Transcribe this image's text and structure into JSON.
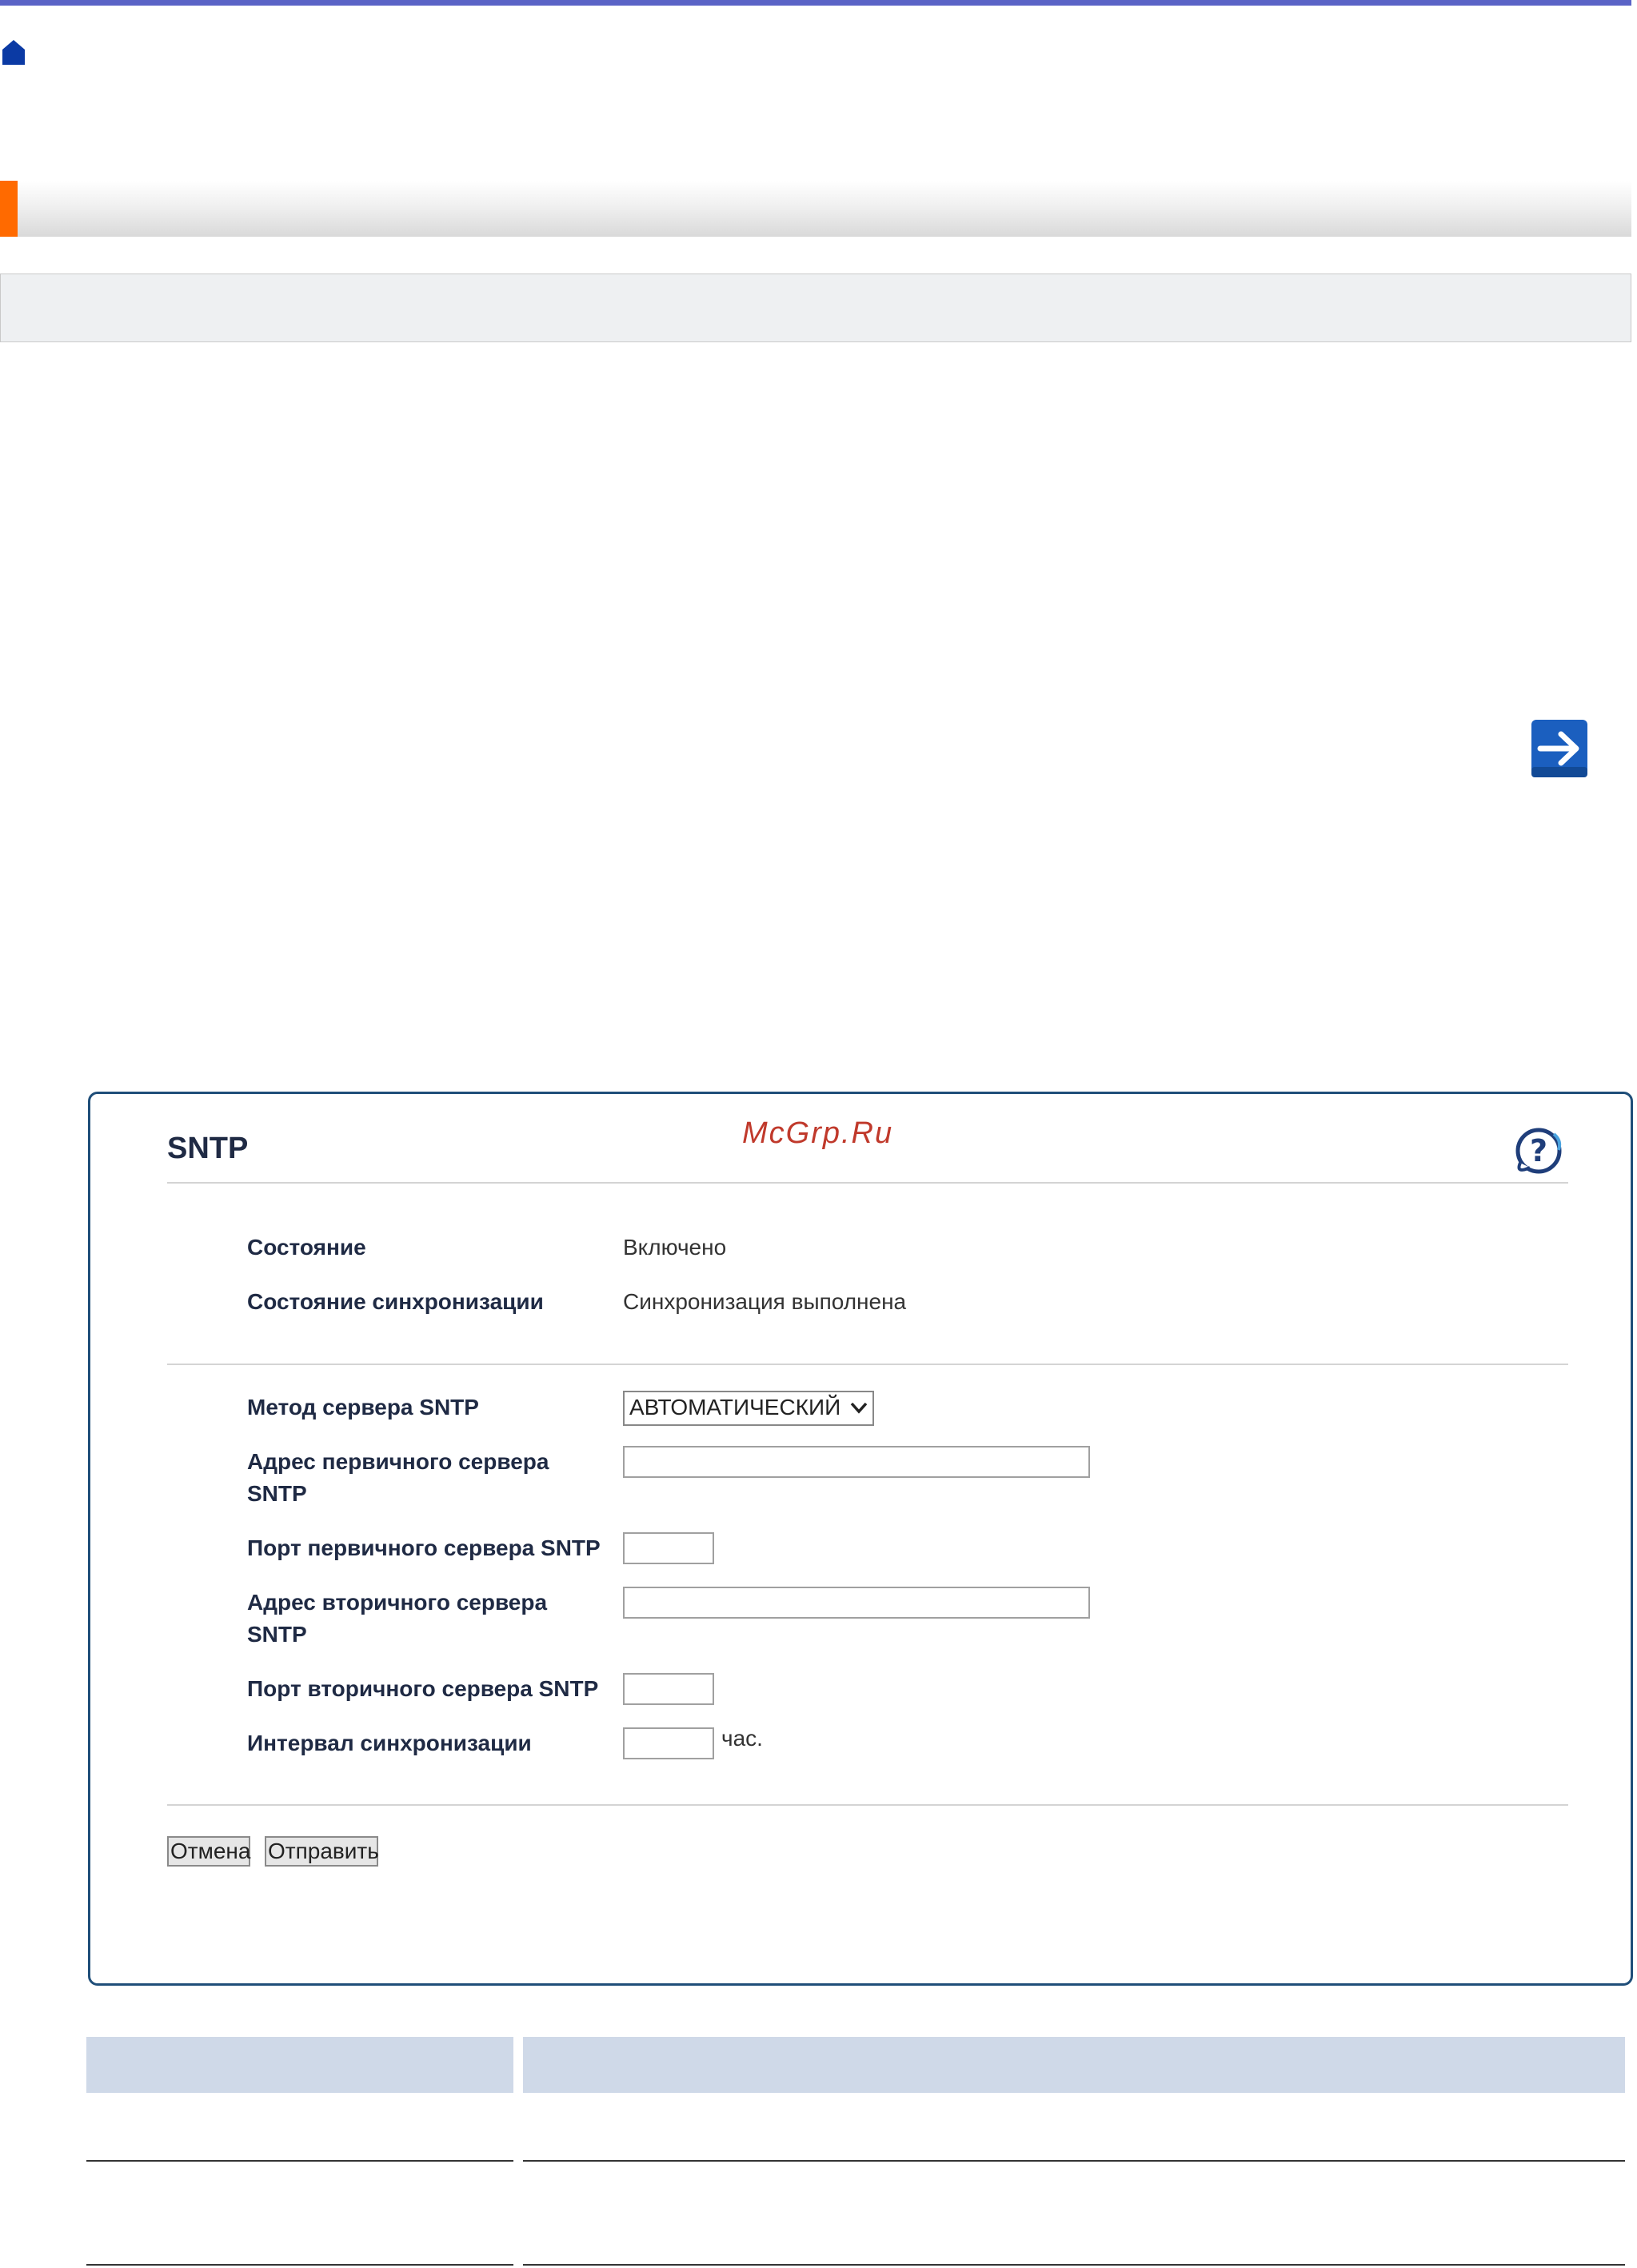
{
  "panel": {
    "title": "SNTP",
    "watermark": "McGrp.Ru",
    "status_label": "Состояние",
    "status_value": "Включено",
    "sync_status_label": "Состояние синхронизации",
    "sync_status_value": "Синхронизация выполнена",
    "method_label": "Метод сервера SNTP",
    "method_value": "АВТОМАТИЧЕСКИЙ",
    "primary_addr_label_1": "Адрес первичного сервера",
    "primary_addr_label_2": "SNTP",
    "primary_addr_value": "",
    "primary_port_label": "Порт первичного сервера SNTP",
    "primary_port_value": "",
    "secondary_addr_label_1": "Адрес вторичного сервера",
    "secondary_addr_label_2": "SNTP",
    "secondary_addr_value": "",
    "secondary_port_label": "Порт вторичного сервера SNTP",
    "secondary_port_value": "",
    "interval_label": "Интервал синхронизации",
    "interval_value": "",
    "interval_unit": "час.",
    "cancel_label": "Отмена",
    "submit_label": "Отправить"
  },
  "icons": {
    "home": "home-icon",
    "next": "arrow-right-icon",
    "help": "help-icon",
    "dropdown": "chevron-down-icon"
  },
  "colors": {
    "top_rule": "#5a63c6",
    "accent": "#ff6a00",
    "panel_border": "#1f4e79",
    "table_header": "#cfd9e8",
    "arrow_button": "#1b5fbf"
  }
}
